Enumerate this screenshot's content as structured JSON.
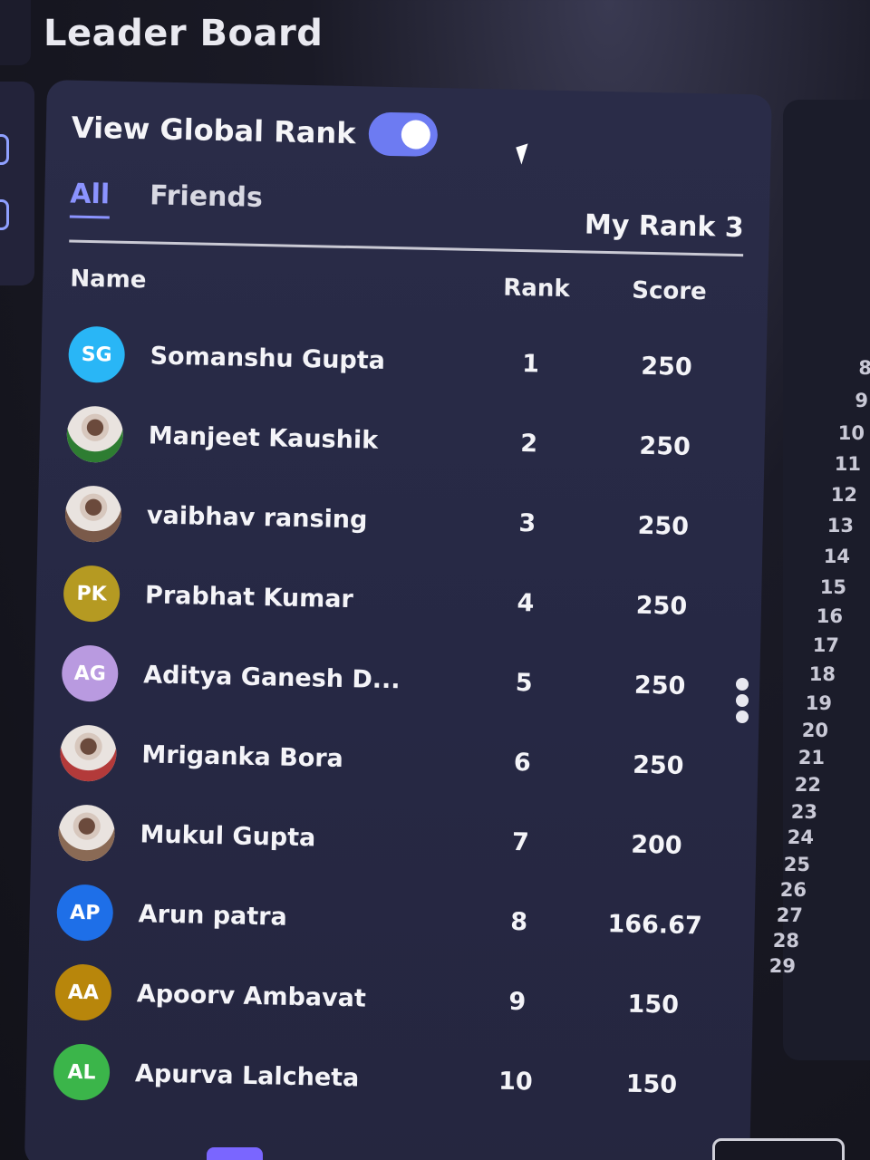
{
  "page": {
    "title": "Leader Board"
  },
  "leaderboard": {
    "global_toggle_label": "View Global Rank",
    "global_toggle_on": true,
    "tabs": [
      {
        "label": "All",
        "active": true
      },
      {
        "label": "Friends",
        "active": false
      }
    ],
    "my_rank": "My Rank 3",
    "columns": {
      "name": "Name",
      "rank": "Rank",
      "score": "Score"
    },
    "rows": [
      {
        "initials": "SG",
        "avatar": "initials",
        "color": "#29b6f6",
        "name": "Somanshu Gupta",
        "rank": "1",
        "score": "250"
      },
      {
        "initials": "",
        "avatar": "photo",
        "color": "#2e7d32",
        "name": "Manjeet Kaushik",
        "rank": "2",
        "score": "250"
      },
      {
        "initials": "",
        "avatar": "photo",
        "color": "#7a5a4a",
        "name": "vaibhav ransing",
        "rank": "3",
        "score": "250"
      },
      {
        "initials": "PK",
        "avatar": "initials",
        "color": "#b59a22",
        "name": "Prabhat Kumar",
        "rank": "4",
        "score": "250"
      },
      {
        "initials": "AG",
        "avatar": "initials",
        "color": "#b99ae0",
        "name": "Aditya Ganesh D...",
        "rank": "5",
        "score": "250"
      },
      {
        "initials": "",
        "avatar": "photo",
        "color": "#b33a3a",
        "name": "Mriganka Bora",
        "rank": "6",
        "score": "250"
      },
      {
        "initials": "",
        "avatar": "photo",
        "color": "#8a6a55",
        "name": "Mukul Gupta",
        "rank": "7",
        "score": "200"
      },
      {
        "initials": "AP",
        "avatar": "initials",
        "color": "#1e6fe8",
        "name": "Arun patra",
        "rank": "8",
        "score": "166.67"
      },
      {
        "initials": "AA",
        "avatar": "initials",
        "color": "#b8860b",
        "name": "Apoorv Ambavat",
        "rank": "9",
        "score": "150"
      },
      {
        "initials": "AL",
        "avatar": "initials",
        "color": "#3bb54a",
        "name": "Apurva Lalcheta",
        "rank": "10",
        "score": "150"
      }
    ]
  },
  "side_panel": {
    "line_numbers": [
      "8",
      "9",
      "10",
      "11",
      "12",
      "13",
      "14",
      "15",
      "16",
      "17",
      "18",
      "19",
      "20",
      "21",
      "22",
      "23",
      "24",
      "25",
      "26",
      "27",
      "28",
      "29"
    ]
  },
  "colors": {
    "accent": "#6d7bf2",
    "tab_active": "#8b93ff",
    "panel_bg": "#2a2c48"
  },
  "icons": {
    "more_menu": "vertical-dots-icon",
    "pointer": "mouse-pointer-icon"
  }
}
